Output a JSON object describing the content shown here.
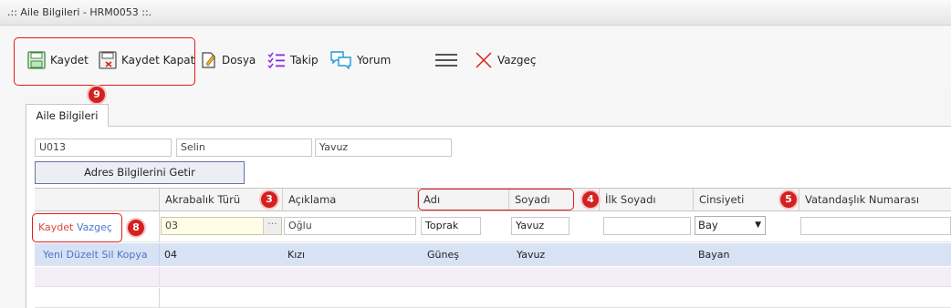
{
  "window": {
    "title": ".:: Aile Bilgileri - HRM0053 ::."
  },
  "toolbar": {
    "save": "Kaydet",
    "save_close": "Kaydet Kapat",
    "file": "Dosya",
    "follow": "Takip",
    "comment": "Yorum",
    "cancel": "Vazgeç"
  },
  "badges": {
    "b9": "9",
    "b8": "8",
    "b3": "3",
    "b4": "4",
    "b5": "5"
  },
  "tab": {
    "label": "Aile Bilgileri"
  },
  "header_fields": {
    "code": "U013",
    "name": "Selin",
    "surname": "Yavuz"
  },
  "address_button": "Adres Bilgilerini Getir",
  "grid": {
    "columns": [
      "Akrabalık Türü",
      "Açıklama",
      "Adı",
      "Soyadı",
      "İlk Soyadı",
      "Cinsiyeti",
      "Vatandaşlık Numarası"
    ],
    "edit_row": {
      "save": "Kaydet",
      "cancel": "Vazgeç",
      "relation": "03",
      "description": "Oğlu",
      "first_name": "Toprak",
      "last_name": "Yavuz",
      "maiden_name": "",
      "gender": "Bay",
      "citizen_no": ""
    },
    "data_row": {
      "actions": "Yeni Düzelt Sil Kopya",
      "relation": "04",
      "description": "Kızı",
      "first_name": "Güneş",
      "last_name": "Yavuz",
      "maiden_name": "",
      "gender": "Bayan",
      "citizen_no": ""
    }
  }
}
